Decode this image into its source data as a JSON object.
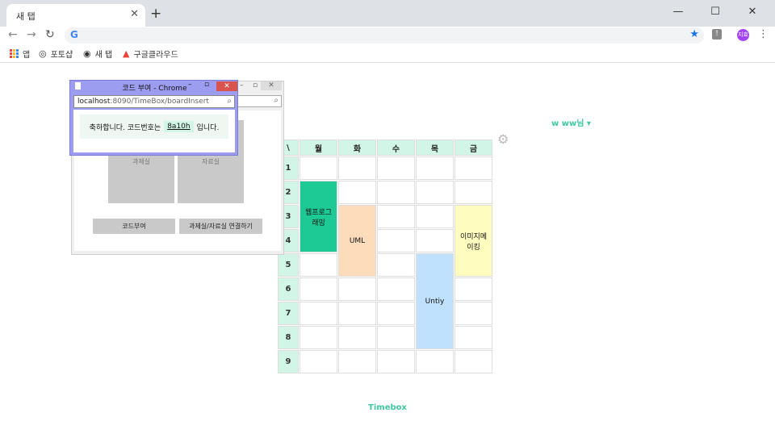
{
  "browser": {
    "tab_title": "새 탭",
    "tab_close": "✕",
    "new_tab": "+",
    "controls": {
      "minimize": "—",
      "maximize": "☐",
      "close": "✕"
    },
    "nav": {
      "back": "←",
      "forward": "→",
      "reload": "↻"
    },
    "omnibox_logo": "G",
    "star": "★",
    "extension": "!",
    "profile_initials": "지효",
    "menu": "⋮"
  },
  "bookmarks": [
    {
      "label": "앱",
      "icon": "apps-grid"
    },
    {
      "label": "포토샵",
      "icon": "globe-icon"
    },
    {
      "label": "새 탭",
      "icon": "globe-icon"
    },
    {
      "label": "구글클라우드",
      "icon": "cloud-icon"
    }
  ],
  "page": {
    "user_label": "w ww님 ▾",
    "settings_icon": "⚙",
    "footer": "Timebox",
    "timetable": {
      "corner": "\\",
      "days": [
        "월",
        "화",
        "수",
        "목",
        "금"
      ],
      "periods": [
        "1",
        "2",
        "3",
        "4",
        "5",
        "6",
        "7",
        "8",
        "9"
      ],
      "subjects": [
        {
          "name": "웹프로그래밍",
          "display": "웹프로그\n래밍",
          "day": 0,
          "start": 1,
          "span": 3,
          "color": "#1dc994"
        },
        {
          "name": "UML",
          "display": "UML",
          "day": 1,
          "start": 2,
          "span": 3,
          "color": "#fddcbc"
        },
        {
          "name": "Untiy",
          "display": "Untiy",
          "day": 3,
          "start": 4,
          "span": 4,
          "color": "#bfe1fd"
        },
        {
          "name": "이미지메이킹",
          "display": "이미지메\n이킹",
          "day": 4,
          "start": 2,
          "span": 3,
          "color": "#fffcc0"
        }
      ]
    }
  },
  "popup_back": {
    "room1": "과제실",
    "room2": "자료실",
    "button_code": "코드부여",
    "button_link": "과제실/자료실 연결하기"
  },
  "popup_front": {
    "title": "코드 부여 - Chrome",
    "url_host": "localhost",
    "url_rest": ":8090/TimeBox/boardInsert",
    "message_before": "축하합니다. 코드번호는",
    "code": "8a10h",
    "message_after": "입니다."
  }
}
